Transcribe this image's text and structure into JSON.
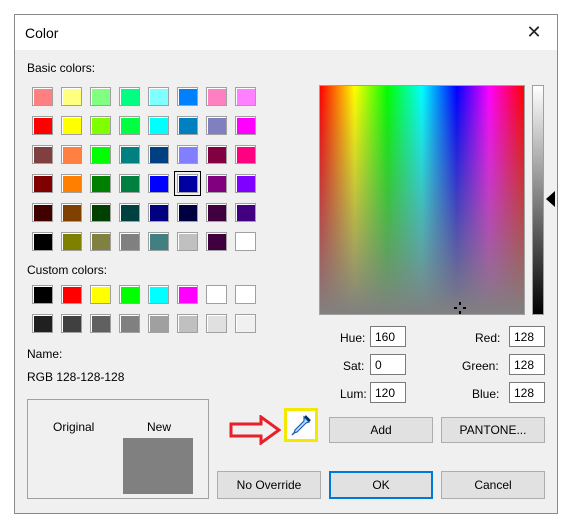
{
  "dialog": {
    "title": "Color"
  },
  "labels": {
    "basic": "Basic colors:",
    "custom": "Custom colors:",
    "name_label": "Name:",
    "name_value": "RGB 128-128-128",
    "original": "Original",
    "new": "New"
  },
  "basic_colors": [
    [
      "#ff8080",
      "#ffff80",
      "#80ff80",
      "#00ff80",
      "#80ffff",
      "#0080ff",
      "#ff80c0",
      "#ff80ff"
    ],
    [
      "#ff0000",
      "#ffff00",
      "#80ff00",
      "#00ff40",
      "#00ffff",
      "#0080c0",
      "#8080c0",
      "#ff00ff"
    ],
    [
      "#804040",
      "#ff8040",
      "#00ff00",
      "#008080",
      "#004080",
      "#8080ff",
      "#800040",
      "#ff0080"
    ],
    [
      "#800000",
      "#ff8000",
      "#008000",
      "#008040",
      "#0000ff",
      "#0000a0",
      "#800080",
      "#8000ff"
    ],
    [
      "#400000",
      "#804000",
      "#004000",
      "#004040",
      "#000080",
      "#000040",
      "#400040",
      "#400080"
    ],
    [
      "#000000",
      "#808000",
      "#808040",
      "#808080",
      "#408080",
      "#c0c0c0",
      "#400040",
      "#ffffff"
    ]
  ],
  "selected_basic": "3-5",
  "custom_colors": [
    [
      "#000000",
      "#ff0000",
      "#ffff00",
      "#00ff00",
      "#00ffff",
      "#ff00ff",
      "#ffffff",
      "#ffffff"
    ],
    [
      "#202020",
      "#404040",
      "#606060",
      "#808080",
      "#a0a0a0",
      "#c0c0c0",
      "#e0e0e0",
      "#f0f0f0"
    ]
  ],
  "hsl": {
    "hue_label": "Hue:",
    "hue": "160",
    "sat_label": "Sat:",
    "sat": "0",
    "lum_label": "Lum:",
    "lum": "120"
  },
  "rgb": {
    "red_label": "Red:",
    "red": "128",
    "green_label": "Green:",
    "green": "128",
    "blue_label": "Blue:",
    "blue": "128"
  },
  "buttons": {
    "add": "Add",
    "pantone": "PANTONE...",
    "no_override": "No Override",
    "ok": "OK",
    "cancel": "Cancel"
  },
  "colors": {
    "original": "#f0f0f0",
    "new": "#808080",
    "annotation_arrow": "#e8202a",
    "annotation_box": "#f5e800"
  }
}
